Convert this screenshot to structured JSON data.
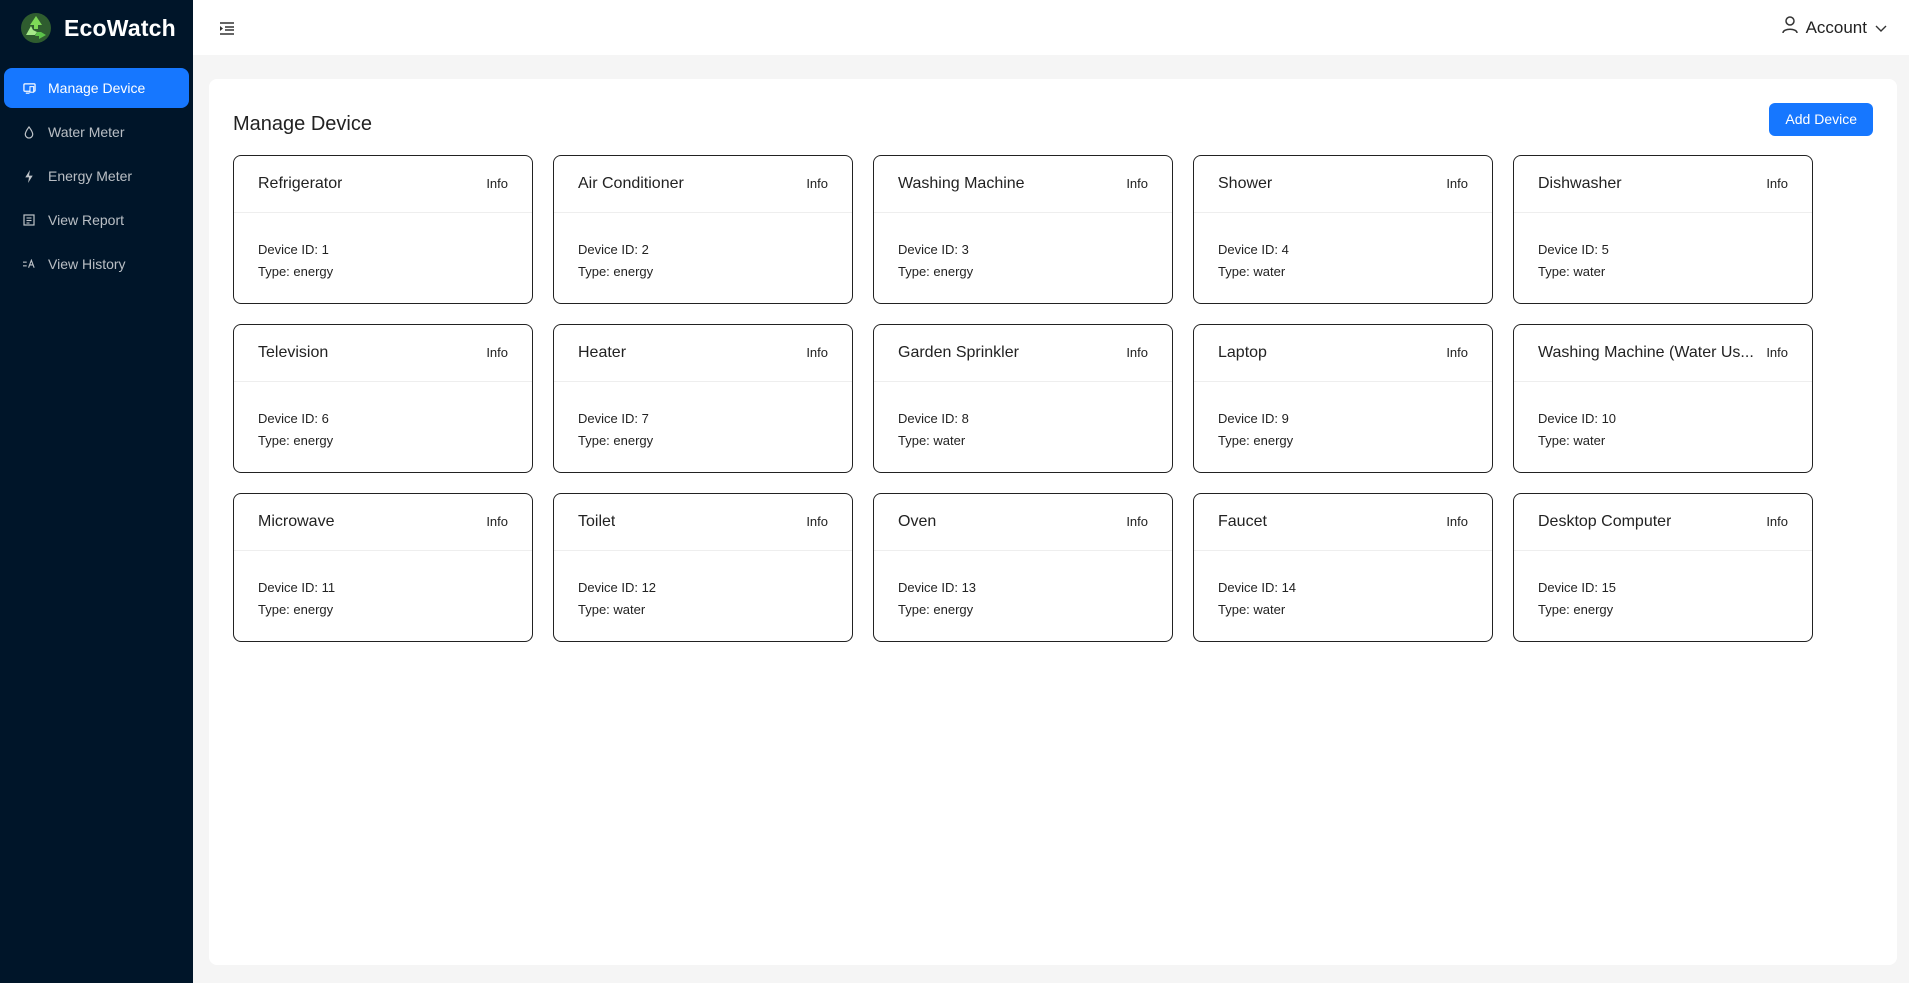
{
  "brand": {
    "name": "EcoWatch"
  },
  "sidebar": {
    "items": [
      {
        "label": "Manage Device",
        "icon": "device-icon",
        "active": true
      },
      {
        "label": "Water Meter",
        "icon": "water-drop-icon",
        "active": false
      },
      {
        "label": "Energy Meter",
        "icon": "lightning-icon",
        "active": false
      },
      {
        "label": "View Report",
        "icon": "report-icon",
        "active": false
      },
      {
        "label": "View History",
        "icon": "history-icon",
        "active": false
      }
    ]
  },
  "header": {
    "account_label": "Account"
  },
  "main": {
    "title": "Manage Device",
    "add_button": "Add Device"
  },
  "devices": [
    {
      "name": "Refrigerator",
      "info": "Info",
      "id_text": "Device ID: 1",
      "type_text": "Type: energy"
    },
    {
      "name": "Air Conditioner",
      "info": "Info",
      "id_text": "Device ID: 2",
      "type_text": "Type: energy"
    },
    {
      "name": "Washing Machine",
      "info": "Info",
      "id_text": "Device ID: 3",
      "type_text": "Type: energy"
    },
    {
      "name": "Shower",
      "info": "Info",
      "id_text": "Device ID: 4",
      "type_text": "Type: water"
    },
    {
      "name": "Dishwasher",
      "info": "Info",
      "id_text": "Device ID: 5",
      "type_text": "Type: water"
    },
    {
      "name": "Television",
      "info": "Info",
      "id_text": "Device ID: 6",
      "type_text": "Type: energy"
    },
    {
      "name": "Heater",
      "info": "Info",
      "id_text": "Device ID: 7",
      "type_text": "Type: energy"
    },
    {
      "name": "Garden Sprinkler",
      "info": "Info",
      "id_text": "Device ID: 8",
      "type_text": "Type: water"
    },
    {
      "name": "Laptop",
      "info": "Info",
      "id_text": "Device ID: 9",
      "type_text": "Type: energy"
    },
    {
      "name": "Washing Machine (Water Us...",
      "info": "Info",
      "id_text": "Device ID: 10",
      "type_text": "Type: water"
    },
    {
      "name": "Microwave",
      "info": "Info",
      "id_text": "Device ID: 11",
      "type_text": "Type: energy"
    },
    {
      "name": "Toilet",
      "info": "Info",
      "id_text": "Device ID: 12",
      "type_text": "Type: water"
    },
    {
      "name": "Oven",
      "info": "Info",
      "id_text": "Device ID: 13",
      "type_text": "Type: energy"
    },
    {
      "name": "Faucet",
      "info": "Info",
      "id_text": "Device ID: 14",
      "type_text": "Type: water"
    },
    {
      "name": "Desktop Computer",
      "info": "Info",
      "id_text": "Device ID: 15",
      "type_text": "Type: energy"
    }
  ],
  "colors": {
    "sidebar_bg": "#001529",
    "accent": "#1677ff",
    "page_bg": "#f5f5f5"
  }
}
